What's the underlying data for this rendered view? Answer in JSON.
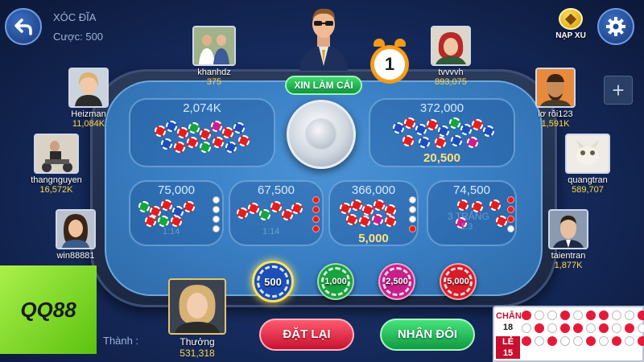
{
  "header": {
    "game_title": "XÓC ĐĨA",
    "bet_label": "Cược: 500"
  },
  "top_right": {
    "napxu_label": "NẠP XU"
  },
  "dealer": {
    "button_label": "XIN LÀM CÁI"
  },
  "timer": {
    "value": "1"
  },
  "players": {
    "heizman": {
      "name": "Heizman",
      "coins": "11,084K"
    },
    "thangnguyen": {
      "name": "thangnguyen",
      "coins": "16,572K"
    },
    "win88881": {
      "name": "win88881",
      "coins": ""
    },
    "khanhdz": {
      "name": "khanhdz",
      "coins": "375"
    },
    "tvvvvh": {
      "name": "tvvvvh",
      "coins": "893,075"
    },
    "lo_roi123": {
      "name": "lơ rồi123",
      "coins": "1,591K"
    },
    "quangtran": {
      "name": "quangtran",
      "coins": "589,707"
    },
    "taientran": {
      "name": "taientran",
      "coins": "1,877K"
    },
    "thuong": {
      "name": "Thưởng",
      "coins": "531,318"
    }
  },
  "bets": {
    "chan": {
      "total": "2,074K"
    },
    "le": {
      "total": "372,000",
      "mine": "20,500"
    },
    "four_red": {
      "total": "75,000",
      "ratio": "1:14"
    },
    "four_white": {
      "total": "67,500",
      "ratio": "1:14"
    },
    "three_red": {
      "total": "366,000",
      "mine": "5,000"
    },
    "three_white": {
      "total": "74,500",
      "ratio": "1:3",
      "watermark": "3 TRẮNG"
    }
  },
  "chips": [
    {
      "label": "500",
      "color": "#1c4fb8",
      "selected": true
    },
    {
      "label": "1,000",
      "color": "#17a33e",
      "selected": false
    },
    {
      "label": "2,500",
      "color": "#c8208a",
      "selected": false
    },
    {
      "label": "5,000",
      "color": "#d81c2a",
      "selected": false
    }
  ],
  "actions": {
    "reset_label": "ĐẶT LẠI",
    "double_label": "NHÂN ĐÔI"
  },
  "history": {
    "chan_label": "CHẴN",
    "chan_count": "18",
    "le_label": "LẺ",
    "le_count": "15",
    "cells": [
      "r",
      "w",
      "w",
      "r",
      "w",
      "r",
      "r",
      "w",
      "w",
      "r",
      "w",
      "r",
      "w",
      "r",
      "r",
      "w",
      "r",
      "w",
      "r",
      "w",
      "r",
      "w",
      "r",
      "w",
      "w",
      "r",
      "w",
      "r",
      "w",
      "r"
    ]
  },
  "overlay": {
    "brand": "QQ88"
  },
  "chat": {
    "partial_text": "Thành :"
  },
  "colors": {
    "accent_green": "#12953c",
    "accent_red": "#c81232",
    "coin_yellow": "#ffd84a",
    "felt_blue": "#3a7fc4"
  }
}
